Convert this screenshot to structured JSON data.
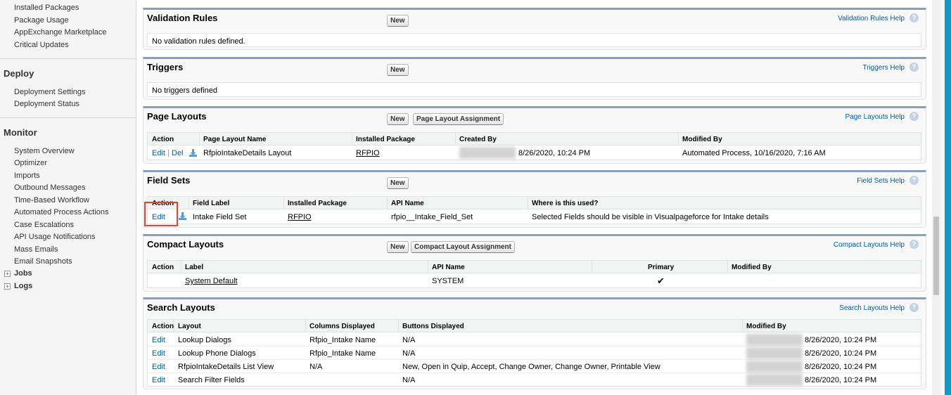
{
  "sidebar": {
    "top_items": [
      "Installed Packages",
      "Package Usage",
      "AppExchange Marketplace",
      "Critical Updates"
    ],
    "deploy": {
      "heading": "Deploy",
      "items": [
        "Deployment Settings",
        "Deployment Status"
      ]
    },
    "monitor": {
      "heading": "Monitor",
      "items": [
        "System Overview",
        "Optimizer",
        "Imports",
        "Outbound Messages",
        "Time-Based Workflow",
        "Automated Process Actions",
        "Case Escalations",
        "API Usage Notifications",
        "Mass Emails",
        "Email Snapshots"
      ],
      "expandable": [
        "Jobs",
        "Logs"
      ],
      "expand_glyph": "+"
    }
  },
  "validation_rules": {
    "title": "Validation Rules",
    "new_label": "New",
    "help": "Validation Rules Help",
    "empty_text": "No validation rules defined."
  },
  "triggers": {
    "title": "Triggers",
    "new_label": "New",
    "help": "Triggers Help",
    "empty_text": "No triggers defined"
  },
  "page_layouts": {
    "title": "Page Layouts",
    "new_label": "New",
    "assign_label": "Page Layout Assignment",
    "help": "Page Layouts Help",
    "columns": [
      "Action",
      "Page Layout Name",
      "Installed Package",
      "Created By",
      "Modified By"
    ],
    "rows": [
      {
        "edit": "Edit",
        "sep": "|",
        "del": "Del",
        "name": "RfpioIntakeDetails Layout",
        "package": "RFPIO",
        "created": "8/26/2020, 10:24 PM",
        "modified": "Automated Process, 10/16/2020, 7:16 AM"
      }
    ]
  },
  "field_sets": {
    "title": "Field Sets",
    "new_label": "New",
    "help": "Field Sets Help",
    "columns": [
      "Action",
      "Field Label",
      "Installed Package",
      "API Name",
      "Where is this used?"
    ],
    "rows": [
      {
        "edit": "Edit",
        "label": "Intake Field Set",
        "package": "RFPIO",
        "api": "rfpio__Intake_Field_Set",
        "where": "Selected Fields should be visible in Visualpageforce for Intake details"
      }
    ]
  },
  "compact_layouts": {
    "title": "Compact Layouts",
    "new_label": "New",
    "assign_label": "Compact Layout Assignment",
    "help": "Compact Layouts Help",
    "columns": [
      "Action",
      "Label",
      "API Name",
      "Primary",
      "Modified By"
    ],
    "rows": [
      {
        "label": "System Default",
        "api": "SYSTEM",
        "primary": "✔"
      }
    ]
  },
  "search_layouts": {
    "title": "Search Layouts",
    "help": "Search Layouts Help",
    "columns": [
      "Action",
      "Layout",
      "Columns Displayed",
      "Buttons Displayed",
      "Modified By"
    ],
    "rows": [
      {
        "edit": "Edit",
        "layout": "Lookup Dialogs",
        "columns": "Rfpio_Intake Name",
        "buttons": "N/A",
        "modified": "8/26/2020, 10:24 PM"
      },
      {
        "edit": "Edit",
        "layout": "Lookup Phone Dialogs",
        "columns": "Rfpio_Intake Name",
        "buttons": "N/A",
        "modified": "8/26/2020, 10:24 PM"
      },
      {
        "edit": "Edit",
        "layout": "RfpioIntakeDetails List View",
        "columns": "N/A",
        "buttons": "New, Open in Quip, Accept, Change Owner, Change Owner, Printable View",
        "modified": "8/26/2020, 10:24 PM"
      },
      {
        "edit": "Edit",
        "layout": "Search Filter Fields",
        "columns": "",
        "buttons": "N/A",
        "modified": "8/26/2020, 10:24 PM"
      }
    ]
  },
  "help_glyph": "?",
  "colors": {
    "link": "#015ba7",
    "panel_border": "#8a9ebe",
    "highlight": "#e8412d",
    "accent": "#1797c0"
  }
}
